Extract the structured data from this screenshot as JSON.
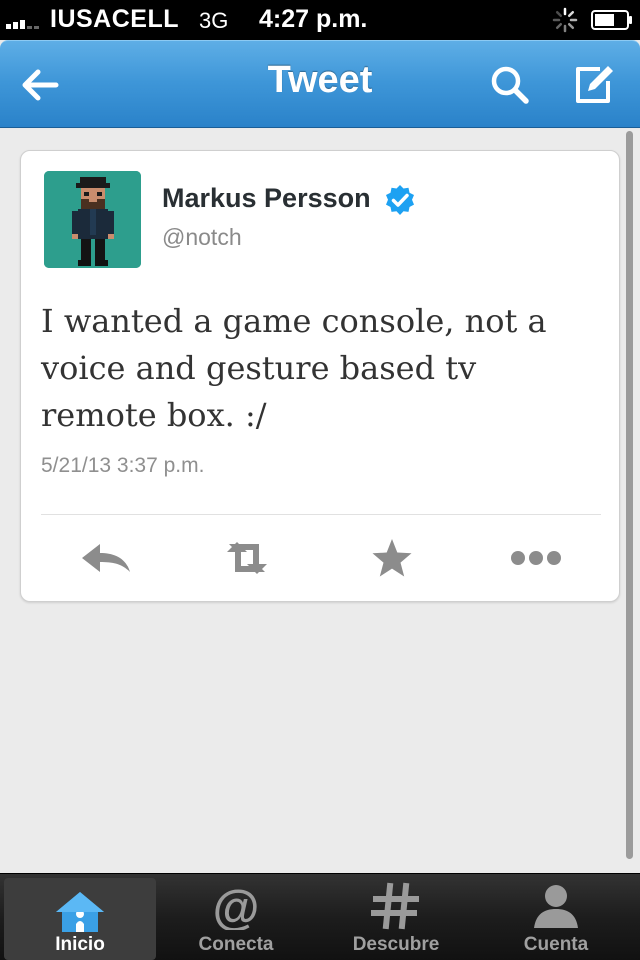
{
  "status_bar": {
    "carrier": "IUSACELL",
    "network": "3G",
    "time": "4:27 p.m."
  },
  "nav": {
    "title": "Tweet"
  },
  "tweet": {
    "name": "Markus Persson",
    "handle": "@notch",
    "text": "I wanted a game console, not a voice and gesture based tv remote box. :/",
    "timestamp": "5/21/13 3:37 p.m."
  },
  "tabs": [
    {
      "label": "Inicio",
      "icon": "home-icon",
      "active": true
    },
    {
      "label": "Conecta",
      "icon": "at-icon",
      "active": false
    },
    {
      "label": "Descubre",
      "icon": "hash-icon",
      "active": false
    },
    {
      "label": "Cuenta",
      "icon": "person-icon",
      "active": false
    }
  ],
  "colors": {
    "nav_blue": "#3e96d8",
    "avatar_teal": "#2d9e8d",
    "verified_blue": "#1da1f2",
    "home_icon_blue": "#3aa0e6"
  }
}
